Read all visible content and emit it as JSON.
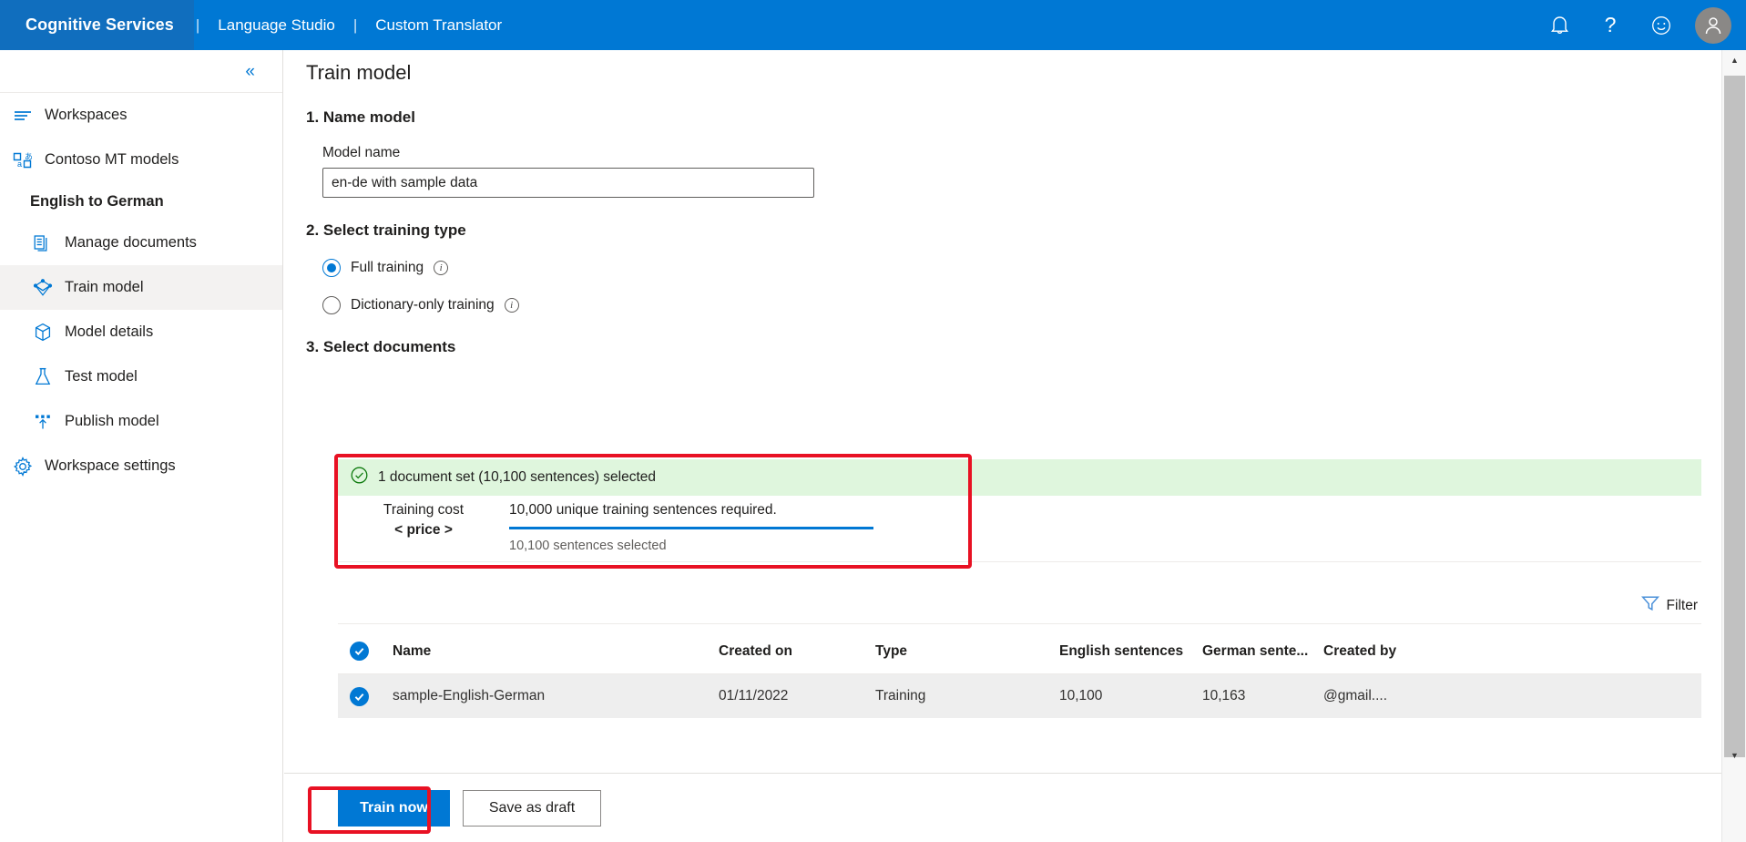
{
  "topbar": {
    "brand": "Cognitive Services",
    "separator": "|",
    "links": [
      "Language Studio",
      "Custom Translator"
    ],
    "icons": [
      "bell-icon",
      "help-icon",
      "feedback-smiley-icon",
      "user-avatar"
    ],
    "brand_bg": "#106ebe",
    "bar_bg": "#0078d4"
  },
  "sidebar": {
    "collapse_glyph": "«",
    "items": [
      {
        "label": "Workspaces",
        "icon": "workspaces-icon",
        "level": "top",
        "active": false
      },
      {
        "label": "Contoso MT models",
        "icon": "mt-models-icon",
        "level": "top",
        "active": false
      },
      {
        "label": "English to German",
        "icon": "",
        "level": "group",
        "active": false
      },
      {
        "label": "Manage documents",
        "icon": "documents-icon",
        "level": "sub",
        "active": false
      },
      {
        "label": "Train model",
        "icon": "train-model-icon",
        "level": "sub",
        "active": true
      },
      {
        "label": "Model details",
        "icon": "box-icon",
        "level": "sub",
        "active": false
      },
      {
        "label": "Test model",
        "icon": "flask-icon",
        "level": "sub",
        "active": false
      },
      {
        "label": "Publish model",
        "icon": "publish-icon",
        "level": "sub",
        "active": false
      },
      {
        "label": "Workspace settings",
        "icon": "gear-icon",
        "level": "top",
        "active": false
      }
    ]
  },
  "main": {
    "page_title": "Train model",
    "step1": {
      "heading": "1. Name model",
      "field_label": "Model name",
      "model_name_value": "en-de with sample data",
      "model_name_placeholder": "Model name"
    },
    "step2": {
      "heading": "2. Select training type",
      "options": [
        {
          "label": "Full training",
          "selected": true,
          "info": "i"
        },
        {
          "label": "Dictionary-only training",
          "selected": false,
          "info": "i"
        }
      ]
    },
    "step3": {
      "heading": "3. Select documents",
      "banner_text": "1 document set (10,100 sentences) selected",
      "banner_icon": "check-circle-icon",
      "banner_bg": "#dff6dd",
      "cost_title": "Training cost",
      "cost_price": "< price >",
      "requirement_text": "10,000 unique training sentences required.",
      "selected_text": "10,100 sentences selected",
      "progress_percent": 100,
      "progress_color": "#0078d4"
    },
    "filter": {
      "label": "Filter",
      "icon": "funnel-icon"
    },
    "table": {
      "columns": [
        "Name",
        "Created on",
        "Type",
        "English sentences",
        "German sente...",
        "Created by"
      ],
      "header_checkbox": "checked",
      "rows": [
        {
          "checked": true,
          "name": "sample-English-German",
          "created_on": "01/11/2022",
          "type": "Training",
          "english_sentences": "10,100",
          "german_sentences": "10,163",
          "created_by": "@gmail...."
        }
      ]
    },
    "footer": {
      "primary_button": "Train now",
      "secondary_button": "Save as draft"
    }
  },
  "annotations": {
    "highlight_color": "#e81123",
    "boxes": [
      "select-documents-panel",
      "train-now-button"
    ]
  }
}
